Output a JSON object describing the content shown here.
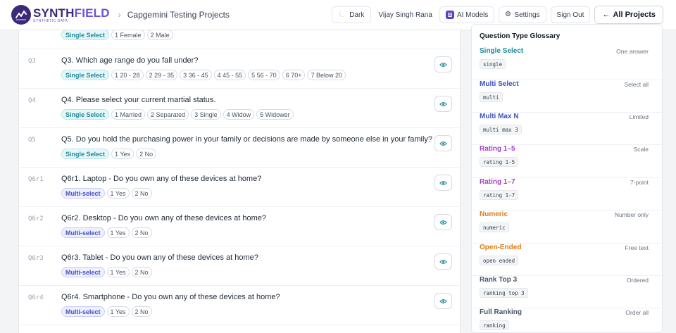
{
  "header": {
    "logo_word_a": "SYNTH",
    "logo_word_b": "FIELD",
    "logo_sub": "SYNTHETIC DATA",
    "project": "Capgemini Testing Projects",
    "dark_label": "Dark",
    "user": "Vijay Singh Rana",
    "ai_models_label": "AI Models",
    "settings_label": "Settings",
    "signout_label": "Sign Out",
    "all_projects_label": "All Projects"
  },
  "questions": [
    {
      "id": "",
      "text": "",
      "type": "Single Select",
      "type_kind": "single",
      "options": [
        "1 Female",
        "2 Male"
      ]
    },
    {
      "id": "Q3",
      "text": "Q3. Which age range do you fall under?",
      "type": "Single Select",
      "type_kind": "single",
      "options": [
        "1 20 - 28",
        "2 29 - 35",
        "3 36 - 45",
        "4 45 - 55",
        "5 56 - 70",
        "6 70+",
        "7 Below 20"
      ]
    },
    {
      "id": "Q4",
      "text": "Q4. Please select your current martial status.",
      "type": "Single Select",
      "type_kind": "single",
      "options": [
        "1 Married",
        "2 Separated",
        "3 Single",
        "4 Widow",
        "5 Widower"
      ]
    },
    {
      "id": "Q5",
      "text": "Q5. Do you hold the purchasing power in your family or decisions are made by someone else in your family?",
      "type": "Single Select",
      "type_kind": "single",
      "options": [
        "1 Yes",
        "2 No"
      ]
    },
    {
      "id": "Q6r1",
      "text": "Q6r1. Laptop - Do you own any of these devices at home?",
      "type": "Multi-select",
      "type_kind": "multi",
      "options": [
        "1 Yes",
        "2 No"
      ]
    },
    {
      "id": "Q6r2",
      "text": "Q6r2. Desktop - Do you own any of these devices at home?",
      "type": "Multi-select",
      "type_kind": "multi",
      "options": [
        "1 Yes",
        "2 No"
      ]
    },
    {
      "id": "Q6r3",
      "text": "Q6r3. Tablet - Do you own any of these devices at home?",
      "type": "Multi-select",
      "type_kind": "multi",
      "options": [
        "1 Yes",
        "2 No"
      ]
    },
    {
      "id": "Q6r4",
      "text": "Q6r4. Smartphone - Do you own any of these devices at home?",
      "type": "Multi-select",
      "type_kind": "multi",
      "options": [
        "1 Yes",
        "2 No"
      ]
    }
  ],
  "glossary": {
    "title": "Question Type Glossary",
    "items": [
      {
        "name": "Single Select",
        "desc": "One answer",
        "code": "single",
        "color": "#1f8a9c"
      },
      {
        "name": "Multi Select",
        "desc": "Select all",
        "code": "multi",
        "color": "#3f51c8"
      },
      {
        "name": "Multi Max N",
        "desc": "Limited",
        "code": "multi max 3",
        "color": "#3f51c8"
      },
      {
        "name": "Rating 1–5",
        "desc": "Scale",
        "code": "rating 1-5",
        "color": "#a340c9"
      },
      {
        "name": "Rating 1–7",
        "desc": "7-point",
        "code": "rating 1-7",
        "color": "#a340c9"
      },
      {
        "name": "Numeric",
        "desc": "Number only",
        "code": "numeric",
        "color": "#e07a12"
      },
      {
        "name": "Open-Ended",
        "desc": "Free text",
        "code": "open ended",
        "color": "#e07a12"
      },
      {
        "name": "Rank Top 3",
        "desc": "Ordered",
        "code": "ranking top 3",
        "color": "#4b5563"
      },
      {
        "name": "Full Ranking",
        "desc": "Order all",
        "code": "ranking",
        "color": "#4b5563"
      }
    ]
  },
  "colors": {
    "brand": "#3b2a7a",
    "brand_light": "#6d52d6",
    "single_accent": "#1f8a9c",
    "multi_accent": "#4451c8"
  },
  "icons": {
    "dark_toggle": "moon-icon",
    "settings": "gear-icon",
    "ai_models": "ai-chip-icon",
    "back": "arrow-left-icon",
    "view": "eye-icon"
  }
}
